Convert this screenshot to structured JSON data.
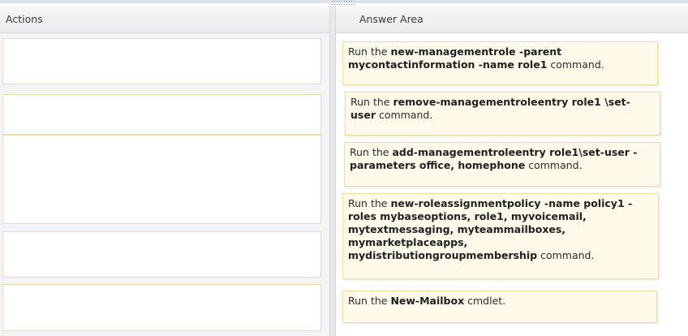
{
  "left_pane": {
    "header": "Actions"
  },
  "right_pane": {
    "header": "Answer Area"
  },
  "answers": [
    {
      "prefix": "Run the ",
      "bold": "new-managementrole -parent mycontactinformation -name role1",
      "suffix": " command."
    },
    {
      "prefix": "Run the ",
      "bold": "remove-managementroleentry role1 \\set-user",
      "suffix": " command."
    },
    {
      "prefix": "Run the ",
      "bold": "add-managementroleentry role1\\set-user -parameters office, homephone",
      "suffix": " command."
    },
    {
      "prefix": "Run the ",
      "bold": "new-roleassignmentpolicy -name policy1 -roles mybaseoptions, role1, myvoicemail, mytextmessaging, myteammailboxes, mymarketplaceapps, mydistributiongroupmembership",
      "suffix": " command."
    },
    {
      "prefix": "Run the ",
      "bold": "New-Mailbox",
      "suffix": " cmdlet."
    }
  ]
}
